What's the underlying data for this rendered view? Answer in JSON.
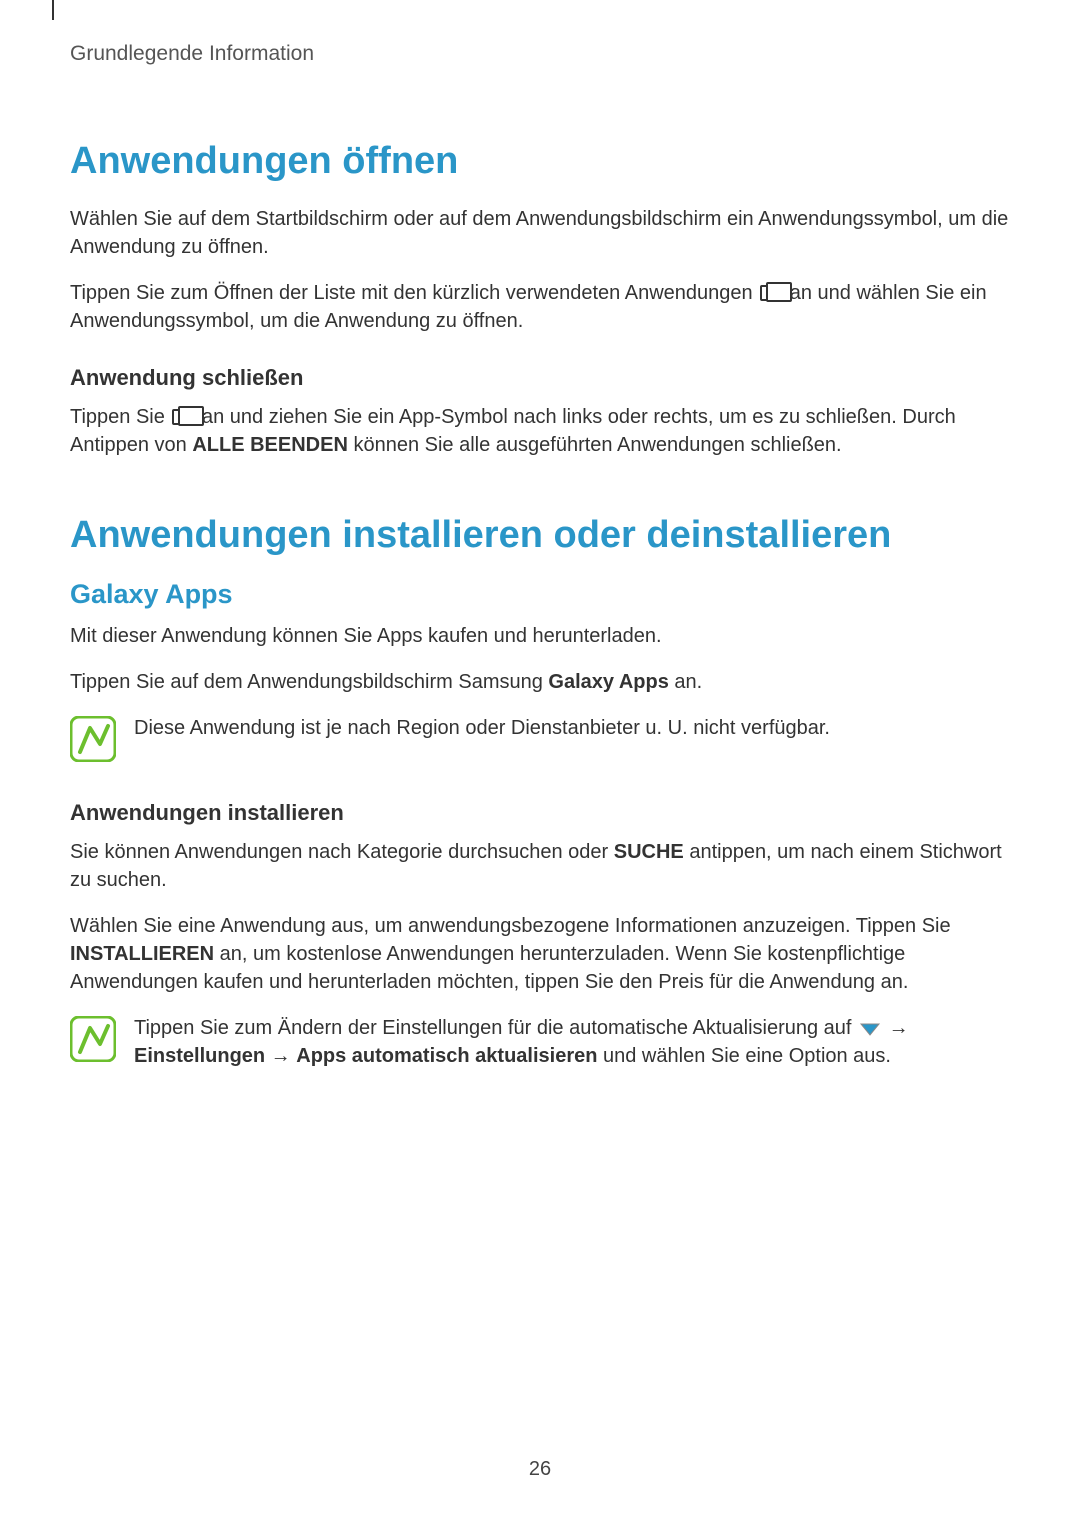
{
  "header": "Grundlegende Information",
  "section1": {
    "title": "Anwendungen öffnen",
    "p1": "Wählen Sie auf dem Startbildschirm oder auf dem Anwendungsbildschirm ein Anwendungssymbol, um die Anwendung zu öffnen.",
    "p2a": "Tippen Sie zum Öffnen der Liste mit den kürzlich verwendeten Anwendungen ",
    "p2b": " an und wählen Sie ein Anwendungssymbol, um die Anwendung zu öffnen.",
    "sub1": {
      "title": "Anwendung schließen",
      "p1a": "Tippen Sie ",
      "p1b": " an und ziehen Sie ein App-Symbol nach links oder rechts, um es zu schließen. Durch Antippen von ",
      "p1_bold": "ALLE BEENDEN",
      "p1c": " können Sie alle ausgeführten Anwendungen schließen."
    }
  },
  "section2": {
    "title": "Anwendungen installieren oder deinstallieren",
    "sub1": {
      "title": "Galaxy Apps",
      "p1": "Mit dieser Anwendung können Sie Apps kaufen und herunterladen.",
      "p2a": "Tippen Sie auf dem Anwendungsbildschirm Samsung ",
      "p2_bold": "Galaxy Apps",
      "p2b": " an.",
      "note1": "Diese Anwendung ist je nach Region oder Dienstanbieter u. U. nicht verfügbar."
    },
    "sub2": {
      "title": "Anwendungen installieren",
      "p1a": "Sie können Anwendungen nach Kategorie durchsuchen oder ",
      "p1_bold": "SUCHE",
      "p1b": " antippen, um nach einem Stichwort zu suchen.",
      "p2a": "Wählen Sie eine Anwendung aus, um anwendungsbezogene Informationen anzuzeigen. Tippen Sie ",
      "p2_bold": "INSTALLIEREN",
      "p2b": " an, um kostenlose Anwendungen herunterzuladen. Wenn Sie kostenpflichtige Anwendungen kaufen und herunterladen möchten, tippen Sie den Preis für die Anwendung an.",
      "note2a": "Tippen Sie zum Ändern der Einstellungen für die automatische Aktualisierung auf ",
      "note2_arrow1": " → ",
      "note2_bold1": "Einstellungen",
      "note2_arrow2": " → ",
      "note2_bold2": "Apps automatisch aktualisieren",
      "note2b": " und wählen Sie eine Option aus."
    }
  },
  "page_number": "26"
}
